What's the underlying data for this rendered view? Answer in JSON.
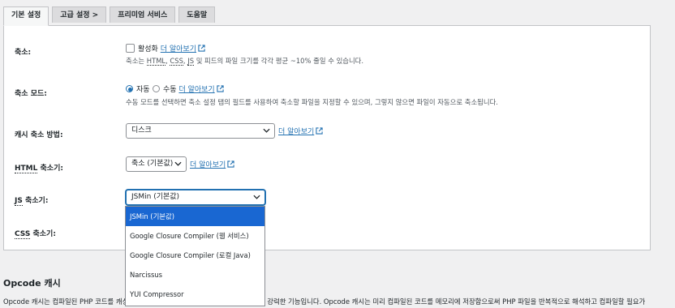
{
  "tabs": [
    {
      "label": "기본 설정",
      "active": true
    },
    {
      "label": "고급 설정 >",
      "active": false
    },
    {
      "label": "프리미엄 서비스",
      "active": false
    },
    {
      "label": "도움말",
      "active": false
    }
  ],
  "learn_more": "더 알아보기",
  "minify": {
    "label": "축소:",
    "checkbox_label": "활성화",
    "checked": false,
    "desc_prefix": "축소는 ",
    "desc_html": "HTML",
    "desc_css": "CSS",
    "desc_js": "JS",
    "desc_suffix": " 및 피드의 파일 크기를 각각 평균 ~10% 줄일 수 있습니다."
  },
  "minify_mode": {
    "label": "축소 모드:",
    "option_auto": "자동",
    "option_manual": "수동",
    "selected": "자동",
    "desc": "수동 모드를 선택하면 축소 설정 탭의 필드를 사용하여 축소할 파일을 지정할 수 있으며, 그렇지 않으면 파일이 자동으로 축소됩니다."
  },
  "cache_method": {
    "label": "캐시 축소 방법:",
    "value": "디스크"
  },
  "html_minifier": {
    "label_abbr": "HTML",
    "label_rest": " 축소기:",
    "value": "축소 (기본값)"
  },
  "js_minifier": {
    "label_abbr": "JS",
    "label_rest": " 축소기:",
    "value": "JSMin (기본값)",
    "options": [
      "JSMin (기본값)",
      "Google Closure Compiler (웹 서비스)",
      "Google Closure Compiler (로컬 Java)",
      "Narcissus",
      "YUI Compressor"
    ]
  },
  "css_minifier": {
    "label_abbr": "CSS",
    "label_rest": " 축소기:"
  },
  "opcode": {
    "title": "Opcode 캐시",
    "desc_left": "Opcode 캐시는 컴파일된 PHP 코드를 캐싱",
    "desc_right": "강력한 기능입니다. Opcode 캐시는 미리 컴파일된 코드를 메모리에 저장함으로써 PHP 파일을 반복적으로 해석하고 컴파일할 필요가"
  },
  "colors": {
    "accent": "#2271b1",
    "selected_option": "#1967d2"
  }
}
